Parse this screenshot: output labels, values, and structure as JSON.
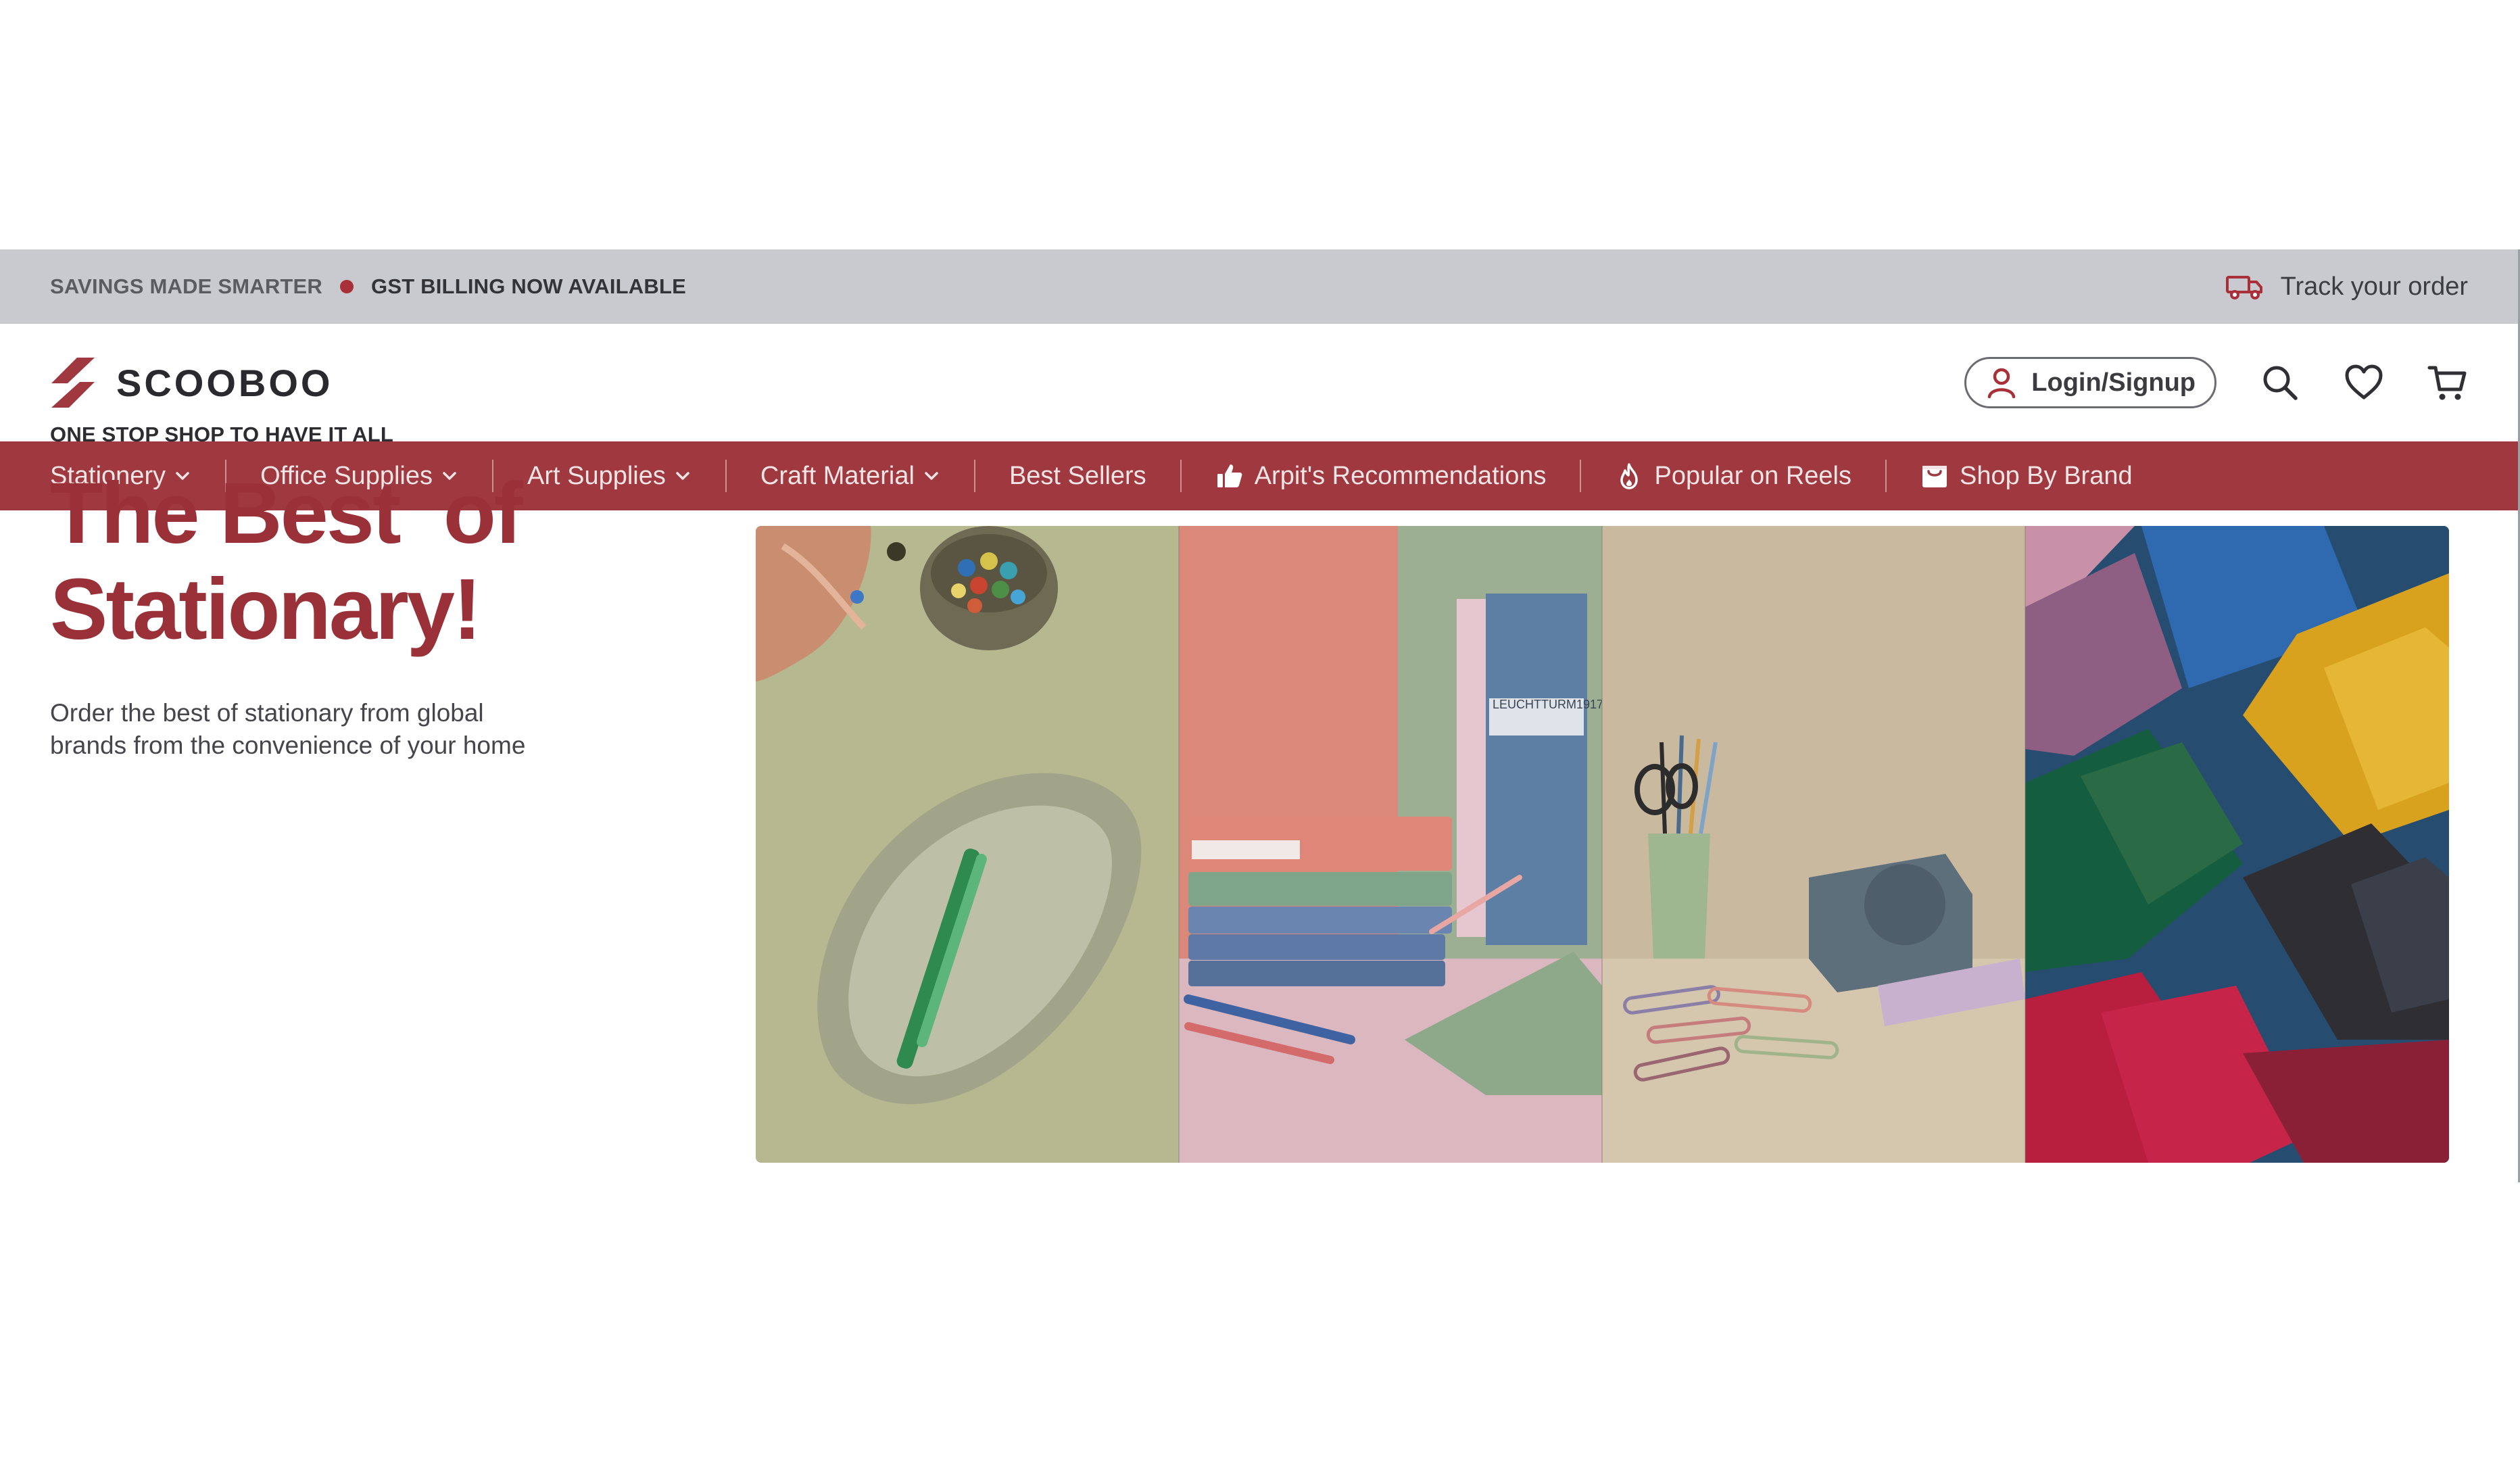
{
  "announcement": {
    "tagline": "SAVINGS MADE SMARTER",
    "notice": "GST BILLING NOW AVAILABLE",
    "track_order": "Track your order"
  },
  "header": {
    "brand_name": "SCOOBOO",
    "login_label": "Login/Signup"
  },
  "nav": {
    "items": [
      {
        "label": "Stationery",
        "icon": "chevron-down-icon"
      },
      {
        "label": "Office Supplies",
        "icon": "chevron-down-icon"
      },
      {
        "label": "Art Supplies",
        "icon": "chevron-down-icon"
      },
      {
        "label": "Craft Material",
        "icon": "chevron-down-icon"
      },
      {
        "label": "Best Sellers",
        "icon": ""
      },
      {
        "label": "Arpit's Recommendations",
        "icon": "thumbs-up-icon"
      },
      {
        "label": "Popular on Reels",
        "icon": "flame-icon"
      },
      {
        "label": "Shop By Brand",
        "icon": "shop-box-icon"
      }
    ]
  },
  "hero": {
    "eyebrow": "ONE STOP SHOP TO HAVE IT ALL",
    "headline_line1": "The Best  of",
    "headline_line2": "Stationary!",
    "subcopy_line1": "Order the best of stationary from global",
    "subcopy_line2": "brands from the convenience of your home",
    "image_label": "LEUCHTTURM1917"
  },
  "colors": {
    "brand": "#a0383f",
    "headline": "#9a3038",
    "announcement_bg": "#c9cacf"
  }
}
